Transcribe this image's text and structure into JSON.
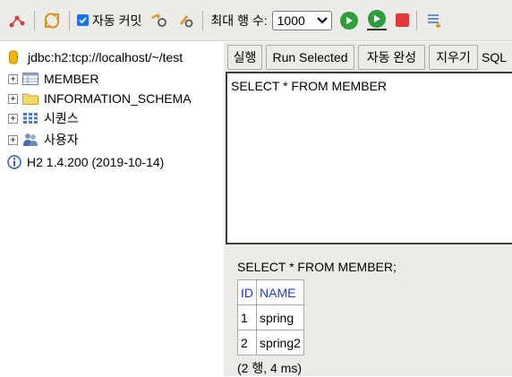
{
  "toolbar": {
    "autocommit_label": "자동 커밋",
    "max_rows_label": "최대 행 수:",
    "max_rows_value": "1000",
    "icons": [
      "disconnect-icon",
      "refresh-icon",
      "rollback-icon",
      "commit-icon",
      "run-icon",
      "run-selected-icon",
      "stop-icon",
      "history-icon"
    ]
  },
  "tree": {
    "connection": "jdbc:h2:tcp://localhost/~/test",
    "items": [
      {
        "label": "MEMBER",
        "icon": "table-icon"
      },
      {
        "label": "INFORMATION_SCHEMA",
        "icon": "folder-icon"
      },
      {
        "label": "시퀀스",
        "icon": "sequence-icon"
      },
      {
        "label": "사용자",
        "icon": "users-icon"
      }
    ],
    "version": "H2 1.4.200 (2019-10-14)"
  },
  "tabs": {
    "run": "실행",
    "run_selected": "Run Selected",
    "autocomplete": "자동 완성",
    "clear": "지우기",
    "sql": "SQL"
  },
  "editor": {
    "text": "SELECT * FROM MEMBER"
  },
  "result": {
    "query": "SELECT * FROM MEMBER;",
    "columns": [
      "ID",
      "NAME"
    ],
    "rows": [
      [
        "1",
        "spring"
      ],
      [
        "2",
        "spring2"
      ]
    ],
    "status": "(2 행, 4 ms)"
  },
  "colors": {
    "accent": "#1a73e8",
    "run": "#2e9e3e",
    "stop": "#e0383b",
    "header_text": "#1f3cc4"
  }
}
